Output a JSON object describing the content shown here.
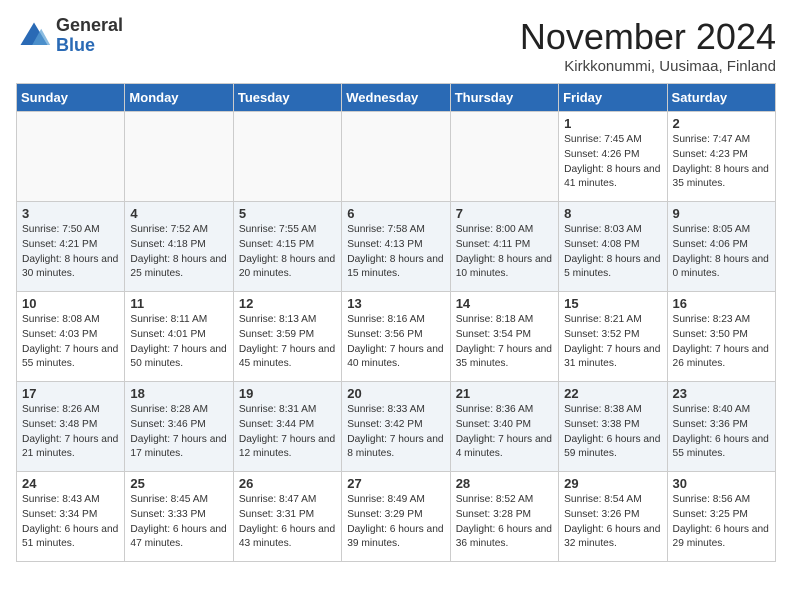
{
  "header": {
    "logo_general": "General",
    "logo_blue": "Blue",
    "month_title": "November 2024",
    "location": "Kirkkonummi, Uusimaa, Finland"
  },
  "days_of_week": [
    "Sunday",
    "Monday",
    "Tuesday",
    "Wednesday",
    "Thursday",
    "Friday",
    "Saturday"
  ],
  "weeks": [
    [
      {
        "day": "",
        "info": ""
      },
      {
        "day": "",
        "info": ""
      },
      {
        "day": "",
        "info": ""
      },
      {
        "day": "",
        "info": ""
      },
      {
        "day": "",
        "info": ""
      },
      {
        "day": "1",
        "info": "Sunrise: 7:45 AM\nSunset: 4:26 PM\nDaylight: 8 hours and 41 minutes."
      },
      {
        "day": "2",
        "info": "Sunrise: 7:47 AM\nSunset: 4:23 PM\nDaylight: 8 hours and 35 minutes."
      }
    ],
    [
      {
        "day": "3",
        "info": "Sunrise: 7:50 AM\nSunset: 4:21 PM\nDaylight: 8 hours and 30 minutes."
      },
      {
        "day": "4",
        "info": "Sunrise: 7:52 AM\nSunset: 4:18 PM\nDaylight: 8 hours and 25 minutes."
      },
      {
        "day": "5",
        "info": "Sunrise: 7:55 AM\nSunset: 4:15 PM\nDaylight: 8 hours and 20 minutes."
      },
      {
        "day": "6",
        "info": "Sunrise: 7:58 AM\nSunset: 4:13 PM\nDaylight: 8 hours and 15 minutes."
      },
      {
        "day": "7",
        "info": "Sunrise: 8:00 AM\nSunset: 4:11 PM\nDaylight: 8 hours and 10 minutes."
      },
      {
        "day": "8",
        "info": "Sunrise: 8:03 AM\nSunset: 4:08 PM\nDaylight: 8 hours and 5 minutes."
      },
      {
        "day": "9",
        "info": "Sunrise: 8:05 AM\nSunset: 4:06 PM\nDaylight: 8 hours and 0 minutes."
      }
    ],
    [
      {
        "day": "10",
        "info": "Sunrise: 8:08 AM\nSunset: 4:03 PM\nDaylight: 7 hours and 55 minutes."
      },
      {
        "day": "11",
        "info": "Sunrise: 8:11 AM\nSunset: 4:01 PM\nDaylight: 7 hours and 50 minutes."
      },
      {
        "day": "12",
        "info": "Sunrise: 8:13 AM\nSunset: 3:59 PM\nDaylight: 7 hours and 45 minutes."
      },
      {
        "day": "13",
        "info": "Sunrise: 8:16 AM\nSunset: 3:56 PM\nDaylight: 7 hours and 40 minutes."
      },
      {
        "day": "14",
        "info": "Sunrise: 8:18 AM\nSunset: 3:54 PM\nDaylight: 7 hours and 35 minutes."
      },
      {
        "day": "15",
        "info": "Sunrise: 8:21 AM\nSunset: 3:52 PM\nDaylight: 7 hours and 31 minutes."
      },
      {
        "day": "16",
        "info": "Sunrise: 8:23 AM\nSunset: 3:50 PM\nDaylight: 7 hours and 26 minutes."
      }
    ],
    [
      {
        "day": "17",
        "info": "Sunrise: 8:26 AM\nSunset: 3:48 PM\nDaylight: 7 hours and 21 minutes."
      },
      {
        "day": "18",
        "info": "Sunrise: 8:28 AM\nSunset: 3:46 PM\nDaylight: 7 hours and 17 minutes."
      },
      {
        "day": "19",
        "info": "Sunrise: 8:31 AM\nSunset: 3:44 PM\nDaylight: 7 hours and 12 minutes."
      },
      {
        "day": "20",
        "info": "Sunrise: 8:33 AM\nSunset: 3:42 PM\nDaylight: 7 hours and 8 minutes."
      },
      {
        "day": "21",
        "info": "Sunrise: 8:36 AM\nSunset: 3:40 PM\nDaylight: 7 hours and 4 minutes."
      },
      {
        "day": "22",
        "info": "Sunrise: 8:38 AM\nSunset: 3:38 PM\nDaylight: 6 hours and 59 minutes."
      },
      {
        "day": "23",
        "info": "Sunrise: 8:40 AM\nSunset: 3:36 PM\nDaylight: 6 hours and 55 minutes."
      }
    ],
    [
      {
        "day": "24",
        "info": "Sunrise: 8:43 AM\nSunset: 3:34 PM\nDaylight: 6 hours and 51 minutes."
      },
      {
        "day": "25",
        "info": "Sunrise: 8:45 AM\nSunset: 3:33 PM\nDaylight: 6 hours and 47 minutes."
      },
      {
        "day": "26",
        "info": "Sunrise: 8:47 AM\nSunset: 3:31 PM\nDaylight: 6 hours and 43 minutes."
      },
      {
        "day": "27",
        "info": "Sunrise: 8:49 AM\nSunset: 3:29 PM\nDaylight: 6 hours and 39 minutes."
      },
      {
        "day": "28",
        "info": "Sunrise: 8:52 AM\nSunset: 3:28 PM\nDaylight: 6 hours and 36 minutes."
      },
      {
        "day": "29",
        "info": "Sunrise: 8:54 AM\nSunset: 3:26 PM\nDaylight: 6 hours and 32 minutes."
      },
      {
        "day": "30",
        "info": "Sunrise: 8:56 AM\nSunset: 3:25 PM\nDaylight: 6 hours and 29 minutes."
      }
    ]
  ]
}
